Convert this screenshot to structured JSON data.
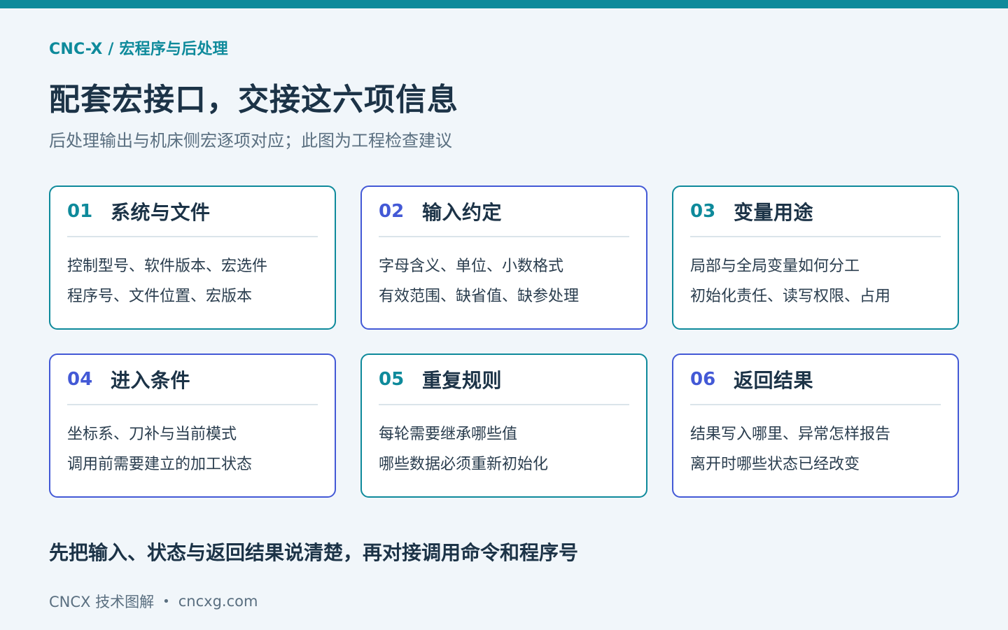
{
  "header": {
    "breadcrumb": "CNC-X / 宏程序与后处理",
    "title": "配套宏接口，交接这六项信息",
    "subtitle": "后处理输出与机床侧宏逐项对应；此图为工程检查建议"
  },
  "cards": [
    {
      "num": "01",
      "title": "系统与文件",
      "lines": [
        "控制型号、软件版本、宏选件",
        "程序号、文件位置、宏版本"
      ],
      "accent": "#0e8a9b"
    },
    {
      "num": "02",
      "title": "输入约定",
      "lines": [
        "字母含义、单位、小数格式",
        "有效范围、缺省值、缺参处理"
      ],
      "accent": "#4359d6"
    },
    {
      "num": "03",
      "title": "变量用途",
      "lines": [
        "局部与全局变量如何分工",
        "初始化责任、读写权限、占用"
      ],
      "accent": "#0e8a9b"
    },
    {
      "num": "04",
      "title": "进入条件",
      "lines": [
        "坐标系、刀补与当前模式",
        "调用前需要建立的加工状态"
      ],
      "accent": "#4359d6"
    },
    {
      "num": "05",
      "title": "重复规则",
      "lines": [
        "每轮需要继承哪些值",
        "哪些数据必须重新初始化"
      ],
      "accent": "#0e8a9b"
    },
    {
      "num": "06",
      "title": "返回结果",
      "lines": [
        "结果写入哪里、异常怎样报告",
        "离开时哪些状态已经改变"
      ],
      "accent": "#4359d6"
    }
  ],
  "conclusion": "先把输入、状态与返回结果说清楚，再对接调用命令和程序号",
  "footer": {
    "brand": "CNCX 技术图解",
    "separator": "•",
    "site": "cncxg.com"
  },
  "colors": {
    "teal": "#0e8a9b",
    "blue": "#4359d6",
    "background": "#f1f6fa"
  }
}
